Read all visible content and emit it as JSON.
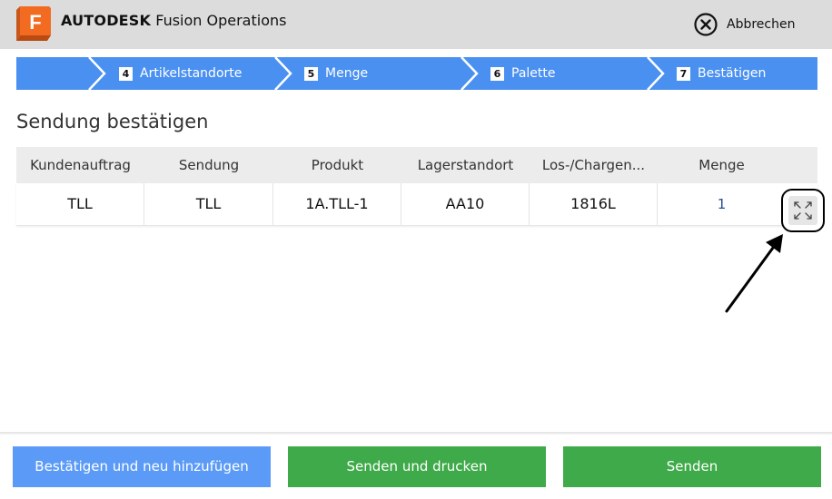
{
  "header": {
    "logo_letter": "F",
    "brand": "AUTODESK",
    "product": "Fusion Operations",
    "cancel_label": "Abbrechen"
  },
  "steps": [
    {
      "number": "4",
      "label": "Artikelstandorte"
    },
    {
      "number": "5",
      "label": "Menge"
    },
    {
      "number": "6",
      "label": "Palette"
    },
    {
      "number": "7",
      "label": "Bestätigen"
    }
  ],
  "page": {
    "title": "Sendung bestätigen"
  },
  "table": {
    "columns": [
      "Kundenauftrag",
      "Sendung",
      "Produkt",
      "Lagerstandort",
      "Los-/Chargen...",
      "Menge"
    ],
    "rows": [
      [
        "TLL",
        "TLL",
        "1A.TLL-1",
        "AA10",
        "1816L",
        "1"
      ]
    ]
  },
  "footer": {
    "confirm_add_label": "Bestätigen und neu hinzufügen",
    "send_print_label": "Senden und drucken",
    "send_label": "Senden"
  },
  "colors": {
    "step_blue": "#4a90f0",
    "button_blue": "#5b9bf7",
    "button_green": "#3eaa49",
    "logo_orange": "#f26b21"
  },
  "icons": {
    "logo": "autodesk-fusion-logo",
    "cancel": "circle-x-icon",
    "expand": "expand-arrows-icon",
    "annotation": "annotation-arrow"
  }
}
